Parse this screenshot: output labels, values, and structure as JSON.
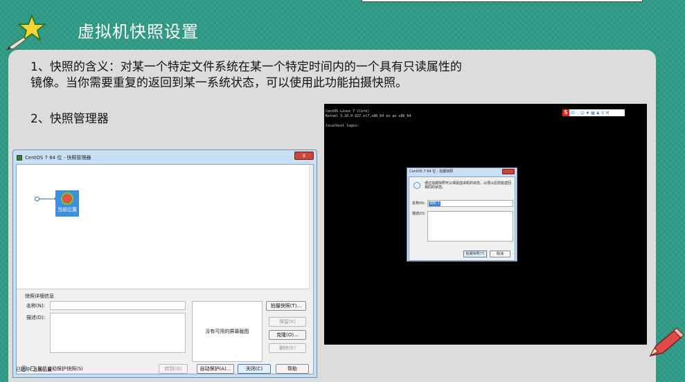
{
  "slide": {
    "title": "虚拟机快照设置",
    "para1_line1": "1、快照的含义：对某一个特定文件系统在某一个特定时间内的一个具有只读属性的",
    "para1_line2": "镜像。当你需要重复的返回到某一系统状态，可以使用此功能拍摄快照。",
    "para2": "2、快照管理器"
  },
  "manager": {
    "title": "CentOS 7 64 位 - 快照管理器",
    "close": "x",
    "node_label": "当前位置",
    "details_group": "快照详细信息",
    "name_label": "名称(N):",
    "desc_label": "描述(D):",
    "no_screenshot": "没有可用的屏幕截图",
    "take_snapshot": "拍摄快照(T)...",
    "keep": "保留(K)",
    "clone": "克隆(O)...",
    "delete": "删除(E)",
    "show_autoprotect": "显示自动保护快照(S)",
    "goto": "转到(G)",
    "autoprotect": "自动保护(A)...",
    "close_btn": "关闭(C)",
    "help": "帮助",
    "status": "已选中\"当前位置\""
  },
  "console": {
    "line1": "CentOS Linux 7 (Core)",
    "line2": "Kernel 3.10.0-327.el7.x86_64 on an x86_64",
    "line3": "localhost login:",
    "ime_logo": "S",
    "ime_text": "中 ·, ☺ ♦ ▦ ♟ ♀ ⚒"
  },
  "snapshot_dialog": {
    "title": "CentOS 7 64 位 - 拍摄快照",
    "info": "通过拍摄快照可以保留虚拟机的状态，以便以后您能返回相同的状态。",
    "name_label": "名称(N):",
    "name_value": "快照 1",
    "desc_label": "描述(D):",
    "take_btn": "拍摄快照(T)",
    "cancel_btn": "取消"
  },
  "colors": {
    "background": "#2f9a85",
    "panel": "#dcdcdc",
    "star": "#f3d23a",
    "pencil": "#e04a4a"
  }
}
